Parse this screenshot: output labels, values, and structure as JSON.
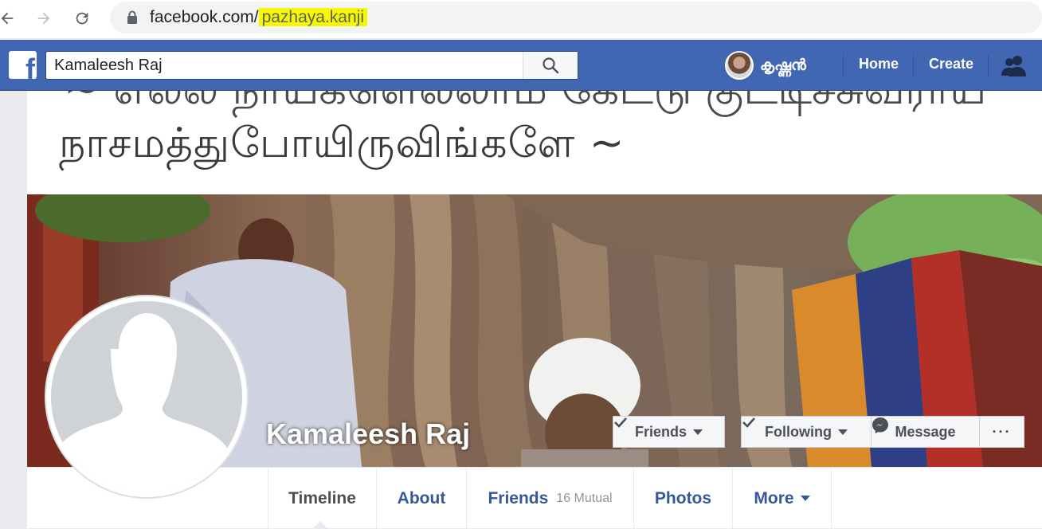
{
  "browser": {
    "url_domain": "facebook.com/",
    "url_path": "pazhaya.kanji"
  },
  "header": {
    "search_value": "Kamaleesh Raj",
    "user_name": "കൃഷ്ണൻ",
    "home_label": "Home",
    "create_label": "Create"
  },
  "post": {
    "line_top": "~ எல்ல நாயகளெல்லாம் கேட்டு குட்டிச்சுவராய்",
    "line_main": "நாசமத்துபோயிருவிங்களே ~"
  },
  "profile": {
    "name": "Kamaleesh Raj",
    "friends_button": "Friends",
    "following_button": "Following",
    "message_button": "Message",
    "more_button": "···"
  },
  "tabs": {
    "timeline": "Timeline",
    "about": "About",
    "friends": "Friends",
    "friends_mutual": "16 Mutual",
    "photos": "Photos",
    "more": "More"
  },
  "colors": {
    "fb_blue": "#4267b2",
    "link_blue": "#365899",
    "url_highlight": "#f7f700"
  }
}
